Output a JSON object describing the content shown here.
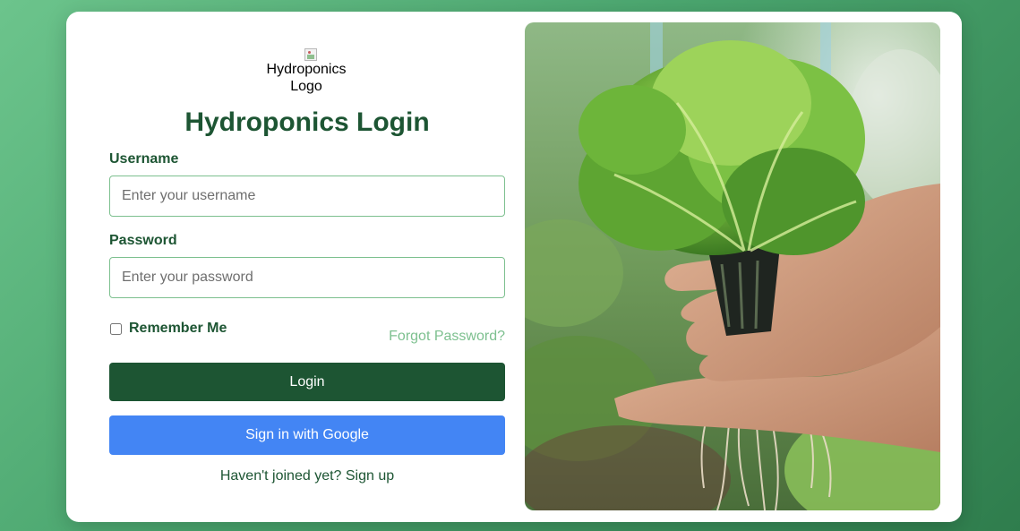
{
  "logo": {
    "alt_text": "Hydroponics Logo"
  },
  "form": {
    "title": "Hydroponics Login",
    "username": {
      "label": "Username",
      "placeholder": "Enter your username",
      "value": ""
    },
    "password": {
      "label": "Password",
      "placeholder": "Enter your password",
      "value": ""
    },
    "remember_me": {
      "label": "Remember Me",
      "checked": false
    },
    "forgot_password": "Forgot Password?",
    "login_button": "Login",
    "google_button": "Sign in with Google",
    "signup_text": "Haven't joined yet? Sign up"
  },
  "colors": {
    "primary_green": "#1d5533",
    "accent_green": "#7dc08f",
    "google_blue": "#4385f4",
    "background_green": "#4aa56e"
  },
  "image": {
    "subject": "hands holding hydroponic lettuce with roots"
  }
}
